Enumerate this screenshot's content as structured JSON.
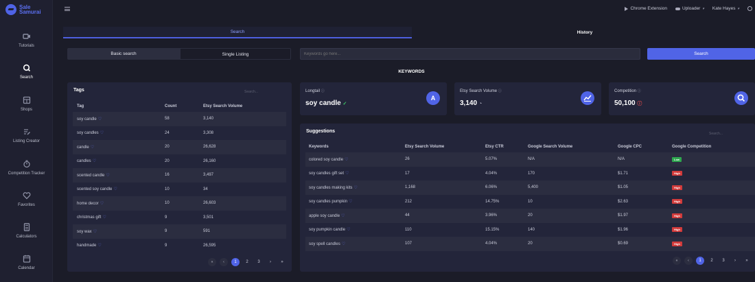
{
  "app": {
    "logo_line1": "Sale",
    "logo_line2": "Samurai"
  },
  "sidebar": {
    "items": [
      {
        "label": "Tutorials",
        "icon": "video-icon"
      },
      {
        "label": "Search",
        "icon": "search-icon"
      },
      {
        "label": "Shops",
        "icon": "shop-icon"
      },
      {
        "label": "Listing Creator",
        "icon": "edit-list-icon"
      },
      {
        "label": "Competition Tracker",
        "icon": "timer-icon"
      },
      {
        "label": "Favorites",
        "icon": "heart-icon"
      },
      {
        "label": "Calculators",
        "icon": "calculator-icon"
      },
      {
        "label": "Calendar",
        "icon": "calendar-icon"
      }
    ]
  },
  "topbar": {
    "chrome_extension": "Chrome Extension",
    "uploader": "Uploader",
    "user_name": "Kate Hayes"
  },
  "tabs": {
    "search": "Search",
    "history": "History"
  },
  "search": {
    "basic": "Basic search",
    "single": "Single Listing",
    "placeholder": "Keywords go here...",
    "button": "Search"
  },
  "keywords_title": "KEYWORDS",
  "tags": {
    "title": "Tags",
    "search_placeholder": "Search...",
    "columns": [
      "Tag",
      "Count",
      "Etsy Search Volume"
    ],
    "rows": [
      {
        "tag": "soy candle",
        "count": "58",
        "volume": "3,140"
      },
      {
        "tag": "soy candles",
        "count": "24",
        "volume": "3,308"
      },
      {
        "tag": "candle",
        "count": "20",
        "volume": "26,628"
      },
      {
        "tag": "candles",
        "count": "20",
        "volume": "26,160"
      },
      {
        "tag": "scented candle",
        "count": "16",
        "volume": "3,497"
      },
      {
        "tag": "scented soy candle",
        "count": "10",
        "volume": "34"
      },
      {
        "tag": "home decor",
        "count": "10",
        "volume": "26,603"
      },
      {
        "tag": "christmas gift",
        "count": "9",
        "volume": "3,501"
      },
      {
        "tag": "soy wax",
        "count": "9",
        "volume": "591"
      },
      {
        "tag": "handmade",
        "count": "9",
        "volume": "26,595"
      }
    ],
    "pager": {
      "first": "«",
      "prev": "‹",
      "pages": [
        "1",
        "2",
        "3"
      ],
      "next": "›",
      "last": "»"
    }
  },
  "cards": {
    "longtail": {
      "label": "Longtail",
      "value": "soy candle",
      "icon_letter": "A"
    },
    "volume": {
      "label": "Etsy Search Volume",
      "value": "3,140"
    },
    "competition": {
      "label": "Competition",
      "value": "50,100"
    }
  },
  "suggestions": {
    "title": "Suggestions",
    "search_placeholder": "Search...",
    "columns": [
      "Keywords",
      "Etsy Search Volume",
      "Etsy CTR",
      "Google Search Volume",
      "Google CPC",
      "Google Competition"
    ],
    "rows": [
      {
        "keyword": "colored soy candle",
        "volume": "26",
        "ctr": "5.07%",
        "gvolume": "N/A",
        "cpc": "N/A",
        "competition": "Low"
      },
      {
        "keyword": "soy candles gift set",
        "volume": "17",
        "ctr": "4.04%",
        "gvolume": "170",
        "cpc": "$1.71",
        "competition": "High"
      },
      {
        "keyword": "soy candles making kits",
        "volume": "1,168",
        "ctr": "6.06%",
        "gvolume": "5,400",
        "cpc": "$1.05",
        "competition": "High"
      },
      {
        "keyword": "soy candles pumpkin",
        "volume": "212",
        "ctr": "14.75%",
        "gvolume": "10",
        "cpc": "$2.63",
        "competition": "High"
      },
      {
        "keyword": "apple soy candle",
        "volume": "44",
        "ctr": "3.96%",
        "gvolume": "20",
        "cpc": "$1.97",
        "competition": "High"
      },
      {
        "keyword": "soy pumpkin candle",
        "volume": "110",
        "ctr": "15.15%",
        "gvolume": "140",
        "cpc": "$1.96",
        "competition": "High"
      },
      {
        "keyword": "soy spell candles",
        "volume": "107",
        "ctr": "4.04%",
        "gvolume": "20",
        "cpc": "$0.69",
        "competition": "High"
      }
    ],
    "pager": {
      "first": "«",
      "prev": "‹",
      "pages": [
        "1",
        "2",
        "3"
      ],
      "next": "›",
      "last": "»"
    }
  },
  "colors": {
    "accent": "#5064e6",
    "background": "#1b1c28",
    "panel": "#23253a",
    "low": "#2ea84f",
    "high": "#d23b3b"
  }
}
